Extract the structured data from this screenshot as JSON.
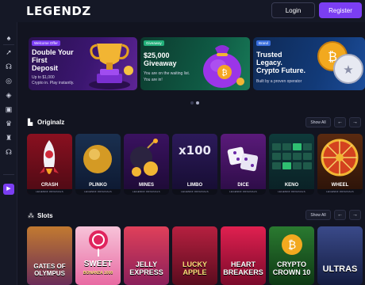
{
  "header": {
    "logo": "LEGENDZ",
    "login_label": "Login",
    "register_label": "Register"
  },
  "sidebar": {
    "icons": [
      "spade-icon",
      "rocket-icon",
      "headset-icon",
      "chip-icon",
      "tag-icon",
      "gift-icon",
      "crown-icon",
      "trophy-icon",
      "support-icon"
    ],
    "active_icon": "play-icon"
  },
  "banners": [
    {
      "tag": "Welcome Offer",
      "title_lines": [
        "Double Your",
        "First",
        "Deposit"
      ],
      "sub_lines": [
        "Up to $1,000",
        "Crypto in. Play instantly."
      ]
    },
    {
      "tag": "Giveaway",
      "title_lines": [
        "$25,000",
        "Giveaway"
      ],
      "sub_lines": [
        "You are on the waiting list.",
        "You are in!"
      ]
    },
    {
      "tag": "Brand",
      "title_lines": [
        "Trusted",
        "Legacy.",
        "Crypto Future."
      ],
      "sub_lines": [
        "Built by a proven operator"
      ]
    }
  ],
  "originals": {
    "title": "Originalz",
    "show_all": "Show All",
    "games": [
      {
        "name": "CRASH",
        "strip": "LEGENDZ ORIGINALS"
      },
      {
        "name": "PLINKO",
        "strip": "LEGENDZ ORIGINALS"
      },
      {
        "name": "MINES",
        "strip": "LEGENDZ ORIGINALS"
      },
      {
        "name": "LIMBO",
        "strip": "LEGENDZ ORIGINALS"
      },
      {
        "name": "DICE",
        "strip": "LEGENDZ ORIGINALS"
      },
      {
        "name": "KENO",
        "strip": "LEGENDZ ORIGINALS"
      },
      {
        "name": "WHEEL",
        "strip": "LEGENDZ ORIGINALS"
      }
    ],
    "limbo_art": "x100"
  },
  "slots": {
    "title": "Slots",
    "show_all": "Show All",
    "games": [
      {
        "title_lines": [
          "GATES OF",
          "OLYMPUS"
        ]
      },
      {
        "title_lines": [
          "SWEET",
          "BONANZA 1000"
        ]
      },
      {
        "title_lines": [
          "JELLY",
          "EXPRESS"
        ]
      },
      {
        "title_lines": [
          "LUCKY",
          "APPLE"
        ]
      },
      {
        "title_lines": [
          "HEART",
          "BREAKERS"
        ]
      },
      {
        "title_lines": [
          "CRYPTO",
          "CROWN 10"
        ]
      },
      {
        "title_lines": [
          "ULTRAS"
        ]
      }
    ]
  },
  "colors": {
    "accent": "#7b3ef2",
    "background": "#121420"
  }
}
